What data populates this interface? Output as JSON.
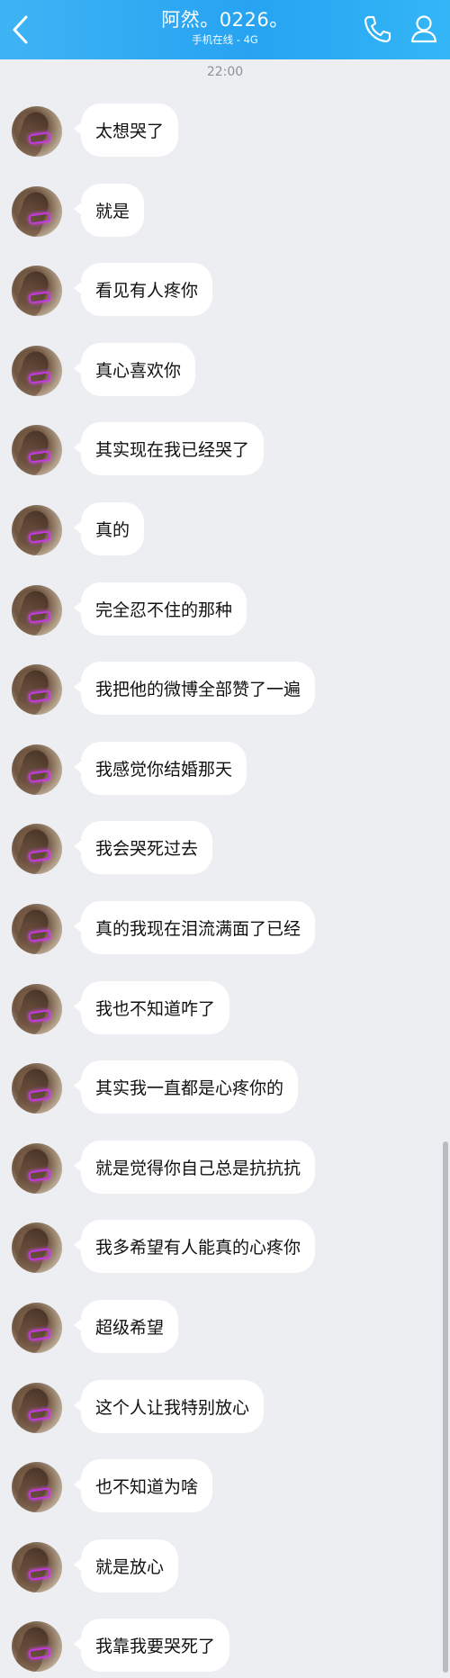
{
  "header": {
    "back_icon": "chevron-left-icon",
    "title": "阿然。0226。",
    "subtitle": "手机在线 - 4G",
    "phone_icon": "phone-icon",
    "profile_icon": "person-icon",
    "colors": {
      "bar": "#29a6f2",
      "text": "#ffffff"
    }
  },
  "timestamp": "22:00",
  "messages": [
    {
      "text": "太想哭了"
    },
    {
      "text": "就是"
    },
    {
      "text": "看见有人疼你"
    },
    {
      "text": "真心喜欢你"
    },
    {
      "text": "其实现在我已经哭了"
    },
    {
      "text": "真的"
    },
    {
      "text": "完全忍不住的那种"
    },
    {
      "text": "我把他的微博全部赞了一遍"
    },
    {
      "text": "我感觉你结婚那天"
    },
    {
      "text": "我会哭死过去"
    },
    {
      "text": "真的我现在泪流满面了已经"
    },
    {
      "text": "我也不知道咋了"
    },
    {
      "text": "其实我一直都是心疼你的"
    },
    {
      "text": "就是觉得你自己总是抗抗抗"
    },
    {
      "text": "我多希望有人能真的心疼你"
    },
    {
      "text": "超级希望"
    },
    {
      "text": "这个人让我特别放心"
    },
    {
      "text": "也不知道为啥"
    },
    {
      "text": "就是放心"
    },
    {
      "text": "我靠我要哭死了"
    }
  ]
}
